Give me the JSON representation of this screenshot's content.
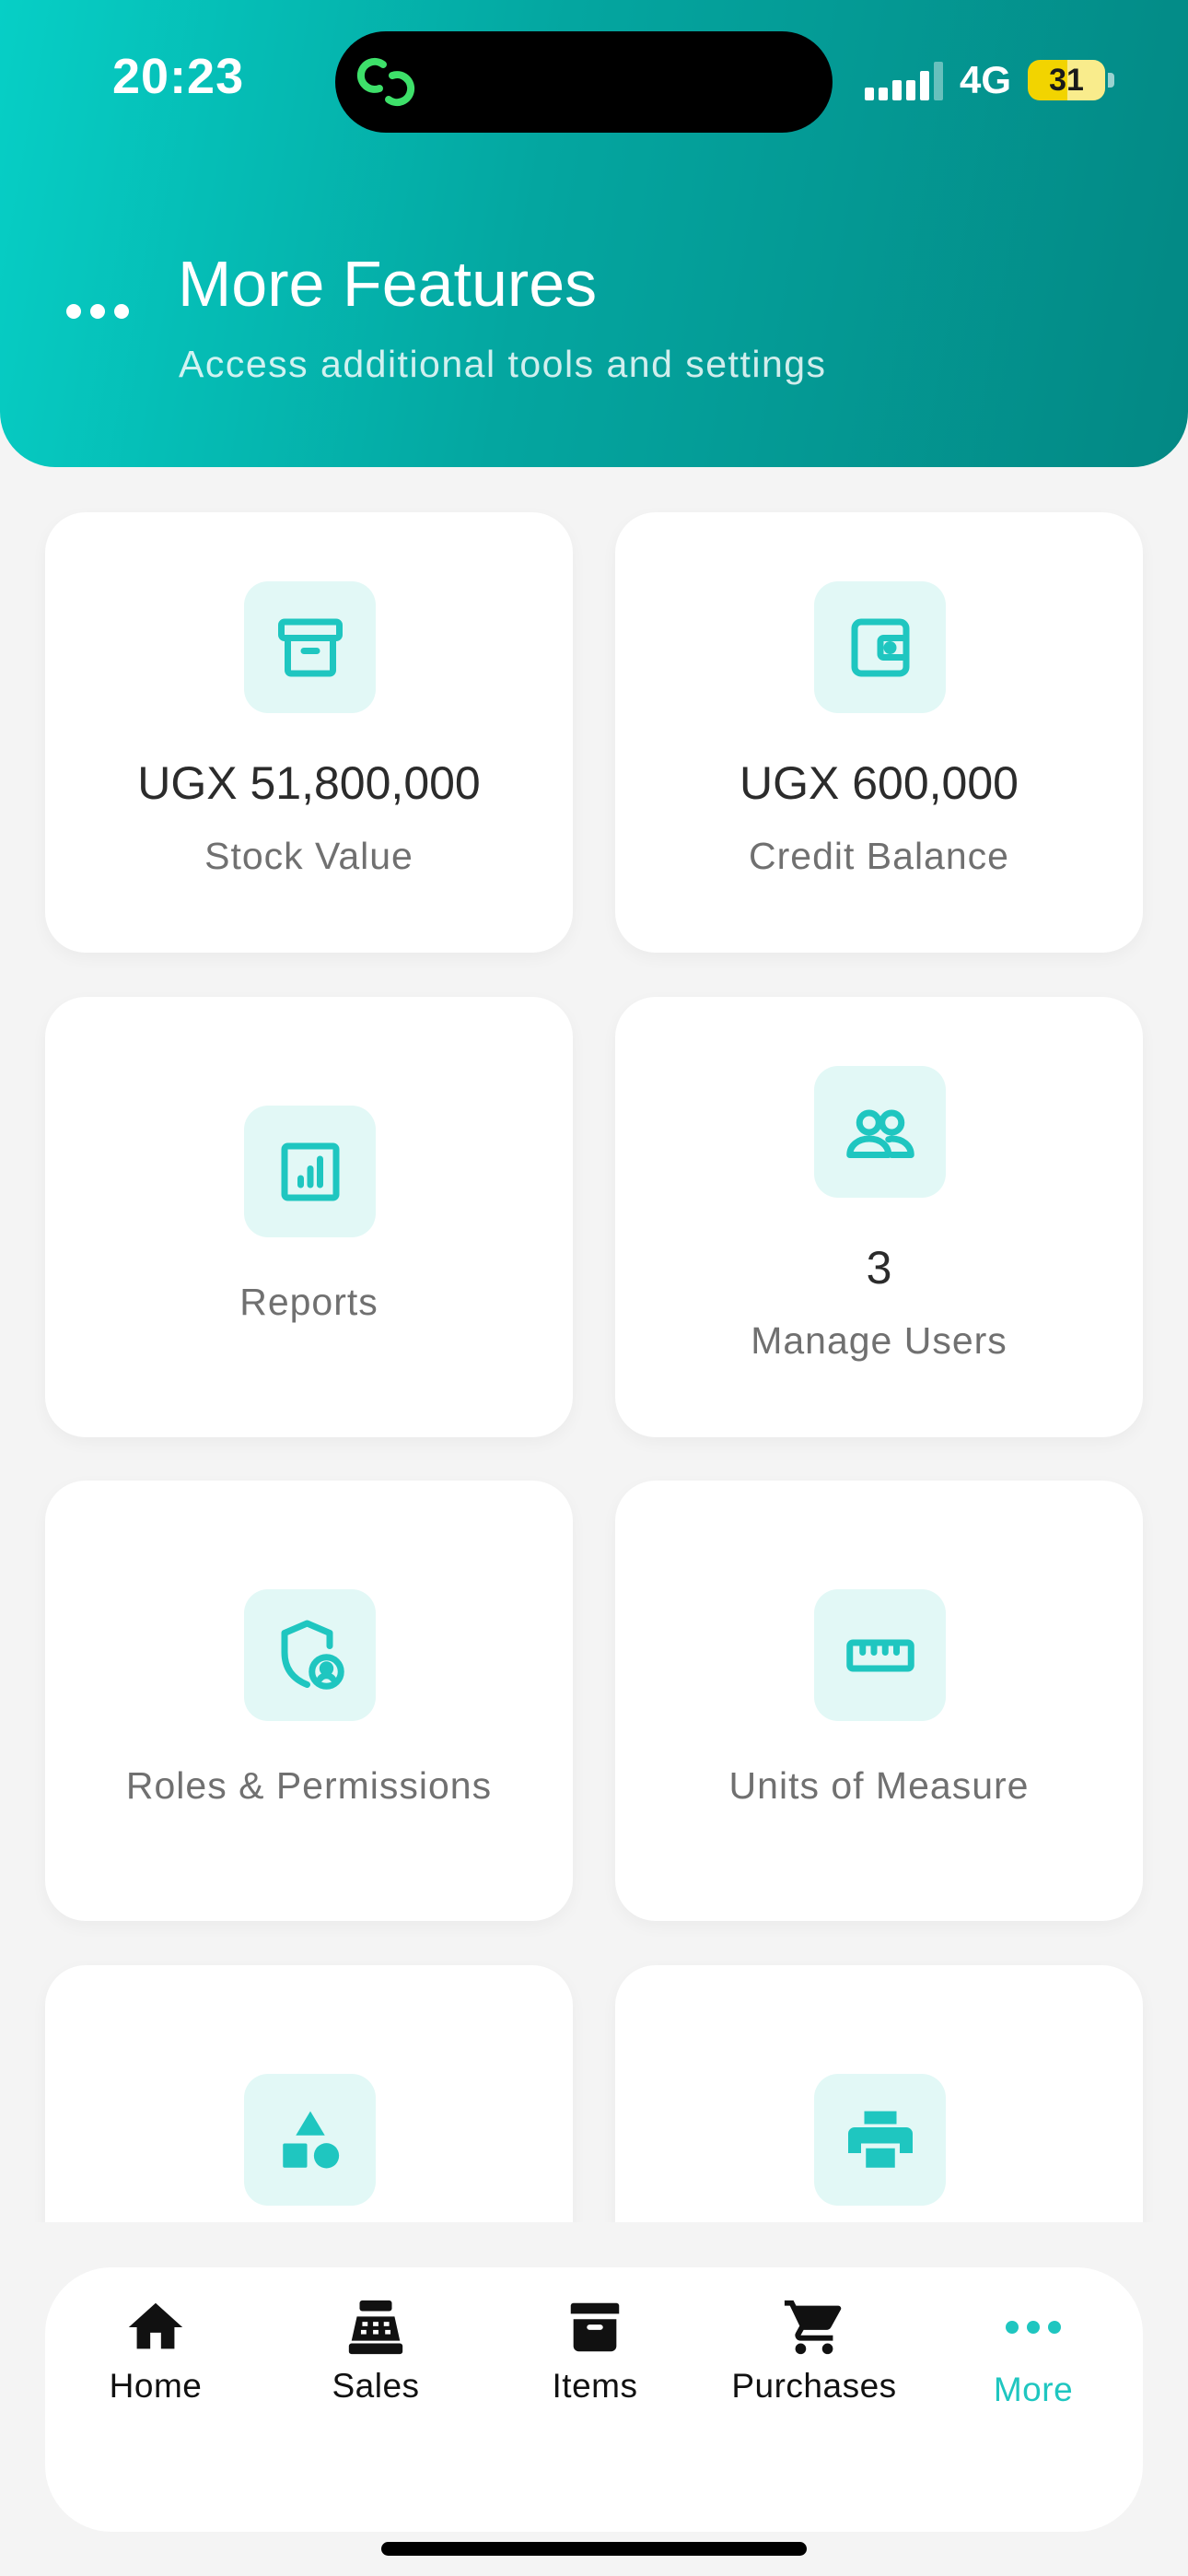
{
  "status_bar": {
    "time": "20:23",
    "network": "4G",
    "battery": "31",
    "battery_level": 0.31
  },
  "header": {
    "menu_icon": "more-horizontal-icon",
    "title": "More Features",
    "subtitle": "Access additional tools and settings"
  },
  "cards": [
    {
      "icon": "archive-box-icon",
      "value": "UGX 51,800,000",
      "label": "Stock Value"
    },
    {
      "icon": "wallet-icon",
      "value": "UGX 600,000",
      "label": "Credit Balance"
    },
    {
      "icon": "report-chart-icon",
      "value": "",
      "label": "Reports"
    },
    {
      "icon": "users-icon",
      "value": "3",
      "label": "Manage Users"
    },
    {
      "icon": "shield-user-icon",
      "value": "",
      "label": "Roles & Permissions"
    },
    {
      "icon": "ruler-icon",
      "value": "",
      "label": "Units of Measure"
    },
    {
      "icon": "shapes-icon",
      "value": "",
      "label": ""
    },
    {
      "icon": "printer-icon",
      "value": "",
      "label": ""
    }
  ],
  "nav": {
    "items": [
      {
        "label": "Home",
        "icon": "home-icon"
      },
      {
        "label": "Sales",
        "icon": "cash-register-icon"
      },
      {
        "label": "Items",
        "icon": "archive-box-icon"
      },
      {
        "label": "Purchases",
        "icon": "cart-icon"
      },
      {
        "label": "More",
        "icon": "more-horizontal-icon",
        "active": true
      }
    ]
  },
  "colors": {
    "accent": "#1fc6c0",
    "header_start": "#06cfc6",
    "header_end": "#038884",
    "icon_tile": "#e2f8f6"
  }
}
